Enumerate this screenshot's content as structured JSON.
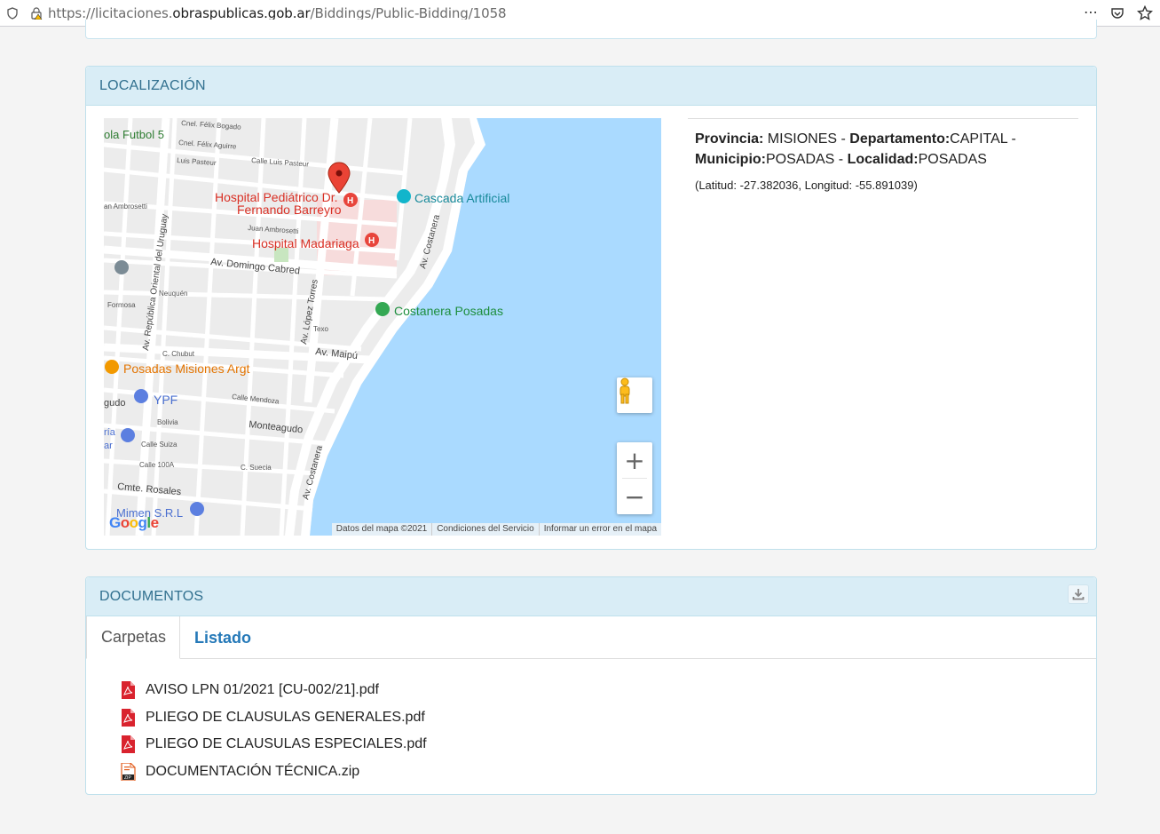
{
  "browser": {
    "url_prefix": "https://licitaciones.",
    "url_domain": "obraspublicas.gob.ar",
    "url_path": "/Biddings/Public-Bidding/1058",
    "menu_icon": "⋯"
  },
  "location_panel": {
    "title": "LOCALIZACIÓN",
    "info": {
      "provincia_label": "Provincia:",
      "provincia_value": " MISIONES - ",
      "departamento_label": "Departamento:",
      "departamento_value": "CAPITAL - ",
      "municipio_label": "Municipio:",
      "municipio_value": "POSADAS - ",
      "localidad_label": "Localidad:",
      "localidad_value": "POSADAS",
      "coordinates": "(Latitud: -27.382036, Longitud: -55.891039)"
    },
    "map": {
      "labels": {
        "futbol": "ola Futbol 5",
        "hospital_pediatrico_1": "Hospital Pediátrico Dr.",
        "hospital_pediatrico_2": "Fernando Barreyro",
        "cascada": "Cascada Artificial",
        "hospital_madariaga": "Hospital Madariaga",
        "costanera_posadas": "Costanera Posadas",
        "posadas_misiones": "Posadas Misiones Argt",
        "ypf": "YPF",
        "mimen": "Mimen S.R.L",
        "av_domingo_cabred": "Av. Domingo Cabred",
        "av_maipu": "Av. Maipú",
        "montea gudo": "Monteagudo",
        "cmte_rosales": "Cmte. Rosales",
        "av_costanera_1": "Av. Costanera",
        "av_costanera_2": "Av. Costanera",
        "av_lopez_torres": "Av. López Torres",
        "av_republica": "Av. República Oriental del Uruguay",
        "cnel_felix_bogado": "Cnel. Félix Bogado",
        "cnel_felix_aguirre": "Cnel. Félix Aguirre",
        "luis_pasteur": "Luis Pasteur",
        "calle_luis_pasteur": "Calle Luis Pasteur",
        "juan_ambrosetti": "Juan Ambrosetti",
        "an_ambrosetti": "an Ambrosetti",
        "neuquen": "Neuquén",
        "formosa": "Formosa",
        "c_chubut": "C. Chubut",
        "calle_mendoza": "Calle Mendoza",
        "bolivia": "Bolivia",
        "calle_suiza": "Calle Suiza",
        "calle_100a": "Calle 100A",
        "c_suecia": "C. Suecia",
        "texo": "Texo",
        "gudo": "gudo",
        "ria": "ría",
        "ar": "ar"
      },
      "footer": {
        "data": "Datos del mapa ©2021",
        "terms": "Condiciones del Servicio",
        "report": "Informar un error en el mapa"
      },
      "google_logo": "Google",
      "zoom_in": "+",
      "zoom_out": "−"
    }
  },
  "documents_panel": {
    "title": "DOCUMENTOS",
    "tabs": [
      {
        "label": "Carpetas"
      },
      {
        "label": "Listado"
      }
    ],
    "files": [
      {
        "name": "AVISO LPN 01/2021 [CU-002/21].pdf",
        "type": "pdf"
      },
      {
        "name": "PLIEGO DE CLAUSULAS GENERALES.pdf",
        "type": "pdf"
      },
      {
        "name": "PLIEGO DE CLAUSULAS ESPECIALES.pdf",
        "type": "pdf"
      },
      {
        "name": "DOCUMENTACIÓN TÉCNICA.zip",
        "type": "zip"
      }
    ]
  },
  "colors": {
    "panel_header_bg": "#d9edf6",
    "panel_header_text": "#31708f",
    "tab_link": "#2579b8",
    "water": "#aadaff",
    "pdf_red": "#d9232e"
  }
}
